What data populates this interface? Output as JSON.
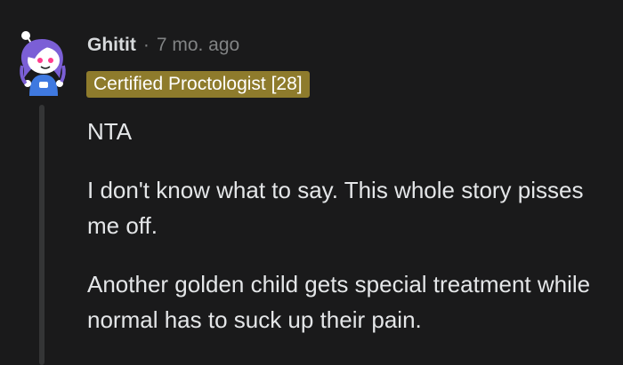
{
  "comment": {
    "username": "Ghitit",
    "separator": "·",
    "age": "7 mo. ago",
    "flair": "Certified Proctologist [28]",
    "paragraphs": [
      "NTA",
      "I don't know what to say. This whole story pisses me off.",
      "Another golden child gets special treatment while normal has to suck up their pain."
    ]
  },
  "colors": {
    "background": "#1a1a1b",
    "flair_bg": "#8e7b2c",
    "thread_line": "#343536",
    "avatar_purple": "#7b5fd6",
    "avatar_blue": "#3f79e0"
  },
  "icons": {
    "avatar": "reddit-snoo-avatar"
  }
}
